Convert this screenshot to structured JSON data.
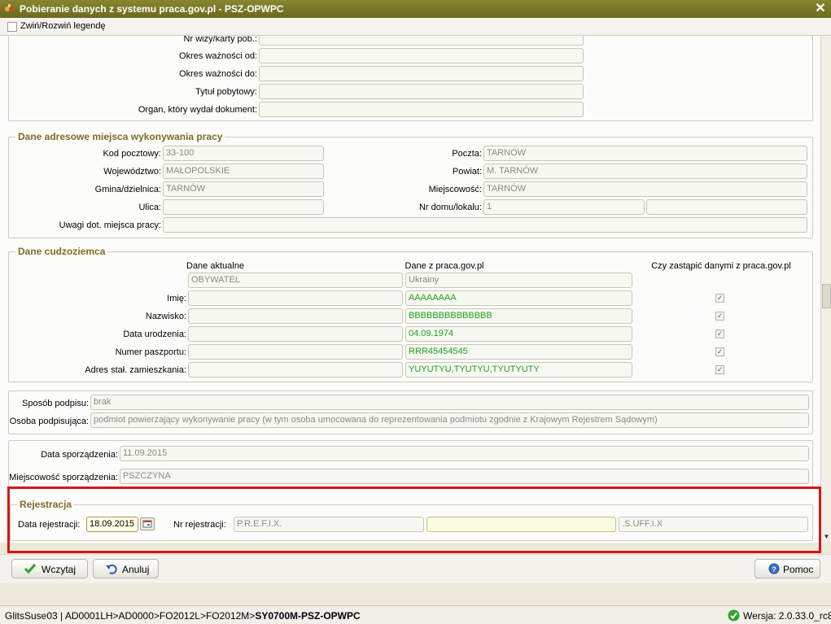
{
  "window": {
    "title": "Pobieranie danych z systemu praca.gov.pl - PSZ-OPWPC",
    "close_glyph": "✕"
  },
  "toolbar": {
    "legend_toggle_label": "Zwiń/Rozwiń legendę"
  },
  "document": {
    "labels": {
      "visa_number": "Nr wizy/karty pob.:",
      "valid_from": "Okres ważności od:",
      "valid_to": "Okres ważności do:",
      "residence_title": "Tytuł pobytowy:",
      "issuing_authority": "Organ, który wydał dokument:"
    },
    "values": {
      "visa_number": "",
      "valid_from": "",
      "valid_to": "",
      "residence_title": "",
      "issuing_authority": ""
    }
  },
  "address": {
    "legend": "Dane adresowe miejsca wykonywania pracy",
    "labels": {
      "postal_code": "Kod pocztowy:",
      "post_office": "Poczta:",
      "voivodeship": "Województwo:",
      "county": "Powiat:",
      "commune": "Gmina/dzielnica:",
      "locality": "Miejscowość:",
      "street": "Ulica:",
      "house_number": "Nr domu/lokalu:",
      "remarks": "Uwagi dot. miejsca pracy:"
    },
    "values": {
      "postal_code": "33-100",
      "post_office": "TARNÓW",
      "voivodeship": "MAŁOPOLSKIE",
      "county": "M. TARNÓW",
      "commune": "TARNÓW",
      "locality": "TARNÓW",
      "street": "",
      "house_number": "1",
      "apartment_number": "",
      "remarks": ""
    }
  },
  "foreigner": {
    "legend": "Dane cudzoziemca",
    "col_current": "Dane aktualne",
    "col_praca": "Dane z praca.gov.pl",
    "col_replace": "Czy zastąpić danymi z praca.gov.pl",
    "citizenship_current": "OBYWATEL",
    "citizenship_praca": "Ukrainy",
    "rows": [
      {
        "label": "Imię:",
        "current": "",
        "praca": "AAAAAAAA",
        "checked": "✓"
      },
      {
        "label": "Nazwisko:",
        "current": "",
        "praca": "BBBBBBBBBBBBBB",
        "checked": "✓"
      },
      {
        "label": "Data urodzenia:",
        "current": "",
        "praca": "04.09.1974",
        "checked": "✓"
      },
      {
        "label": "Numer paszportu:",
        "current": "",
        "praca": "RRR45454545",
        "checked": "✓"
      },
      {
        "label": "Adres stał. zamieszkania:",
        "current": "",
        "praca": "YUYUTYU,TYUTYU,TYUTYUTY",
        "checked": "✓"
      }
    ]
  },
  "signature": {
    "method_label": "Sposób podpisu:",
    "method_value": "brak",
    "signer_label": "Osoba podpisująca:",
    "signer_value": "podmiot powierzający wykonywanie pracy (w tym osoba umocowana do reprezentowania podmiotu zgodnie z Krajowym Rejestrem Sądowym)"
  },
  "prepared": {
    "date_label": "Data sporządzenia:",
    "date_value": "11.09.2015",
    "place_label": "Miejscowość sporządzenia:",
    "place_value": "PSZCZYNA"
  },
  "registration": {
    "legend": "Rejestracja",
    "date_label": "Data rejestracji:",
    "date_value": "18.09.2015",
    "number_label": "Nr rejestracji:",
    "prefix": "P.R.E.F.I.X.",
    "middle": "",
    "suffix": ".S.UFF.I.X"
  },
  "buttons": {
    "load": "Wczytaj",
    "cancel": "Anuluj",
    "help": "Pomoc"
  },
  "status": {
    "path_prefix": "GlitsSuse03 | AD0001LH>AD0000>FO2012L>FO2012M>",
    "path_bold": "SY0700M-PSZ-OPWPC",
    "version": "Wersja: 2.0.33.0_rc8"
  },
  "colors": {
    "title_bar": "#7a7826",
    "legend_text": "#7a6d28",
    "highlight": "#d8141c",
    "praca_value": "#1aa51a"
  }
}
